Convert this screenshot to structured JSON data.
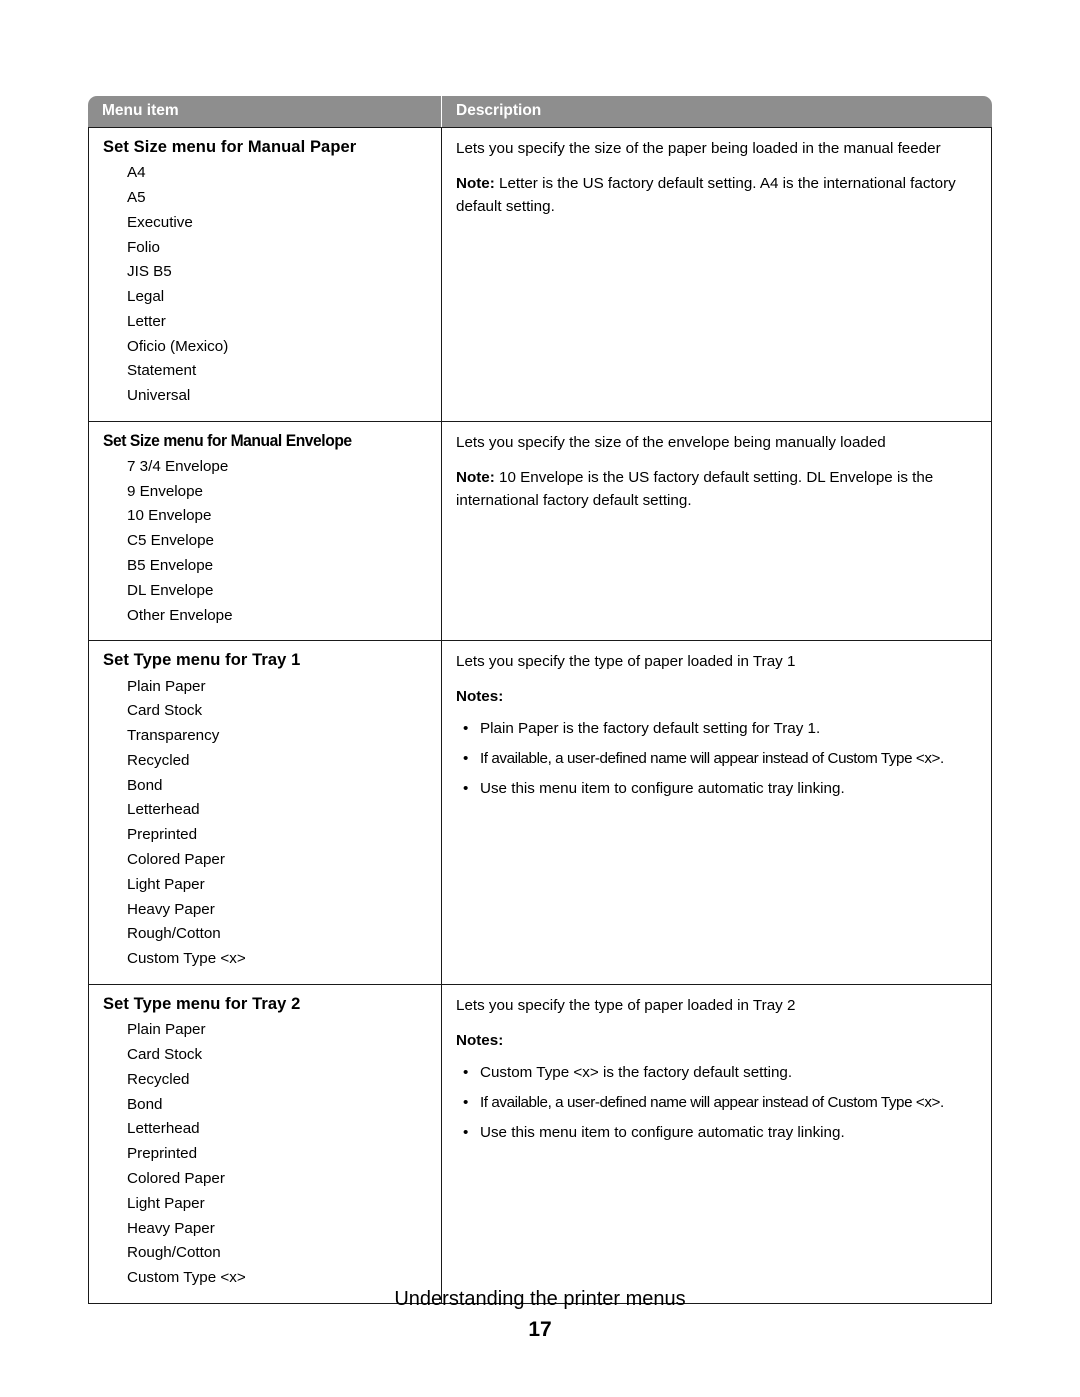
{
  "document": {
    "table": {
      "headers": {
        "menu_item": "Menu item",
        "description": "Description"
      },
      "rows": [
        {
          "title": "Set Size menu for Manual Paper",
          "condensed_title": false,
          "options": [
            "A4",
            "A5",
            "Executive",
            "Folio",
            "JIS B5",
            "Legal",
            "Letter",
            "Oficio (Mexico)",
            "Statement",
            "Universal"
          ],
          "description_intro": "Lets you specify the size of the paper being loaded in the manual feeder",
          "note_label": "Note:",
          "note_text": " Letter is the US factory default setting. A4 is the international factory default setting.",
          "notes_heading": "",
          "bullets": []
        },
        {
          "title": "Set Size menu for Manual Envelope",
          "condensed_title": true,
          "options": [
            "7 3/4 Envelope",
            "9 Envelope",
            "10 Envelope",
            "C5 Envelope",
            "B5 Envelope",
            "DL Envelope",
            "Other Envelope"
          ],
          "description_intro": "Lets you specify the size of the envelope being manually loaded",
          "note_label": "Note:",
          "note_text": " 10 Envelope is the US factory default setting. DL Envelope is the international factory default setting.",
          "notes_heading": "",
          "bullets": []
        },
        {
          "title": "Set Type menu for Tray 1",
          "condensed_title": false,
          "options": [
            "Plain Paper",
            "Card Stock",
            "Transparency",
            "Recycled",
            "Bond",
            "Letterhead",
            "Preprinted",
            "Colored Paper",
            "Light Paper",
            "Heavy Paper",
            "Rough/Cotton",
            "Custom Type <x>"
          ],
          "description_intro": "Lets you specify the type of paper loaded in Tray 1",
          "note_label": "",
          "note_text": "",
          "notes_heading": "Notes:",
          "bullets": [
            {
              "text": "Plain Paper is the factory default setting for Tray 1.",
              "tight": false
            },
            {
              "text": "If available, a user-defined name will appear instead of Custom Type <x>.",
              "tight": true
            },
            {
              "text": "Use this menu item to configure automatic tray linking.",
              "tight": false
            }
          ]
        },
        {
          "title": "Set Type menu for Tray 2",
          "condensed_title": false,
          "options": [
            "Plain Paper",
            "Card Stock",
            "Recycled",
            "Bond",
            "Letterhead",
            "Preprinted",
            "Colored Paper",
            "Light Paper",
            "Heavy Paper",
            "Rough/Cotton",
            "Custom Type <x>"
          ],
          "description_intro": "Lets you specify the type of paper loaded in Tray 2",
          "note_label": "",
          "note_text": "",
          "notes_heading": "Notes:",
          "bullets": [
            {
              "text": "Custom Type <x> is the factory default setting.",
              "tight": false
            },
            {
              "text": "If available, a user-defined name will appear instead of Custom Type <x>.",
              "tight": true
            },
            {
              "text": "Use this menu item to configure automatic tray linking.",
              "tight": false
            }
          ]
        }
      ]
    },
    "footer": {
      "section_title": "Understanding the printer menus",
      "page_number": "17"
    },
    "colors": {
      "header_background": "#8e8e8e",
      "header_text": "#ffffff",
      "border": "#1a1a1a",
      "page_background": "#ffffff",
      "body_text": "#000000"
    },
    "icons": {
      "bullet": "•"
    }
  }
}
